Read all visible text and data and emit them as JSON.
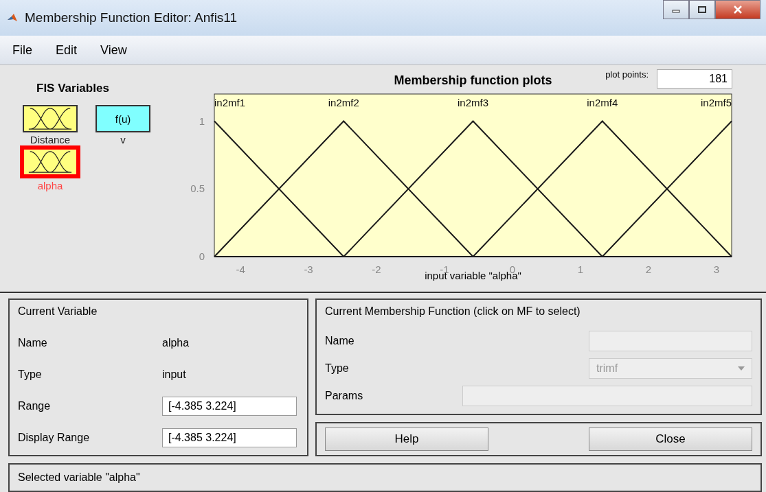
{
  "window": {
    "title": "Membership Function Editor: Anfis11"
  },
  "menu": [
    "File",
    "Edit",
    "View"
  ],
  "fis_variables": {
    "title": "FIS Variables",
    "items": [
      {
        "name": "Distance",
        "kind": "input",
        "selected": false
      },
      {
        "name": "v",
        "kind": "output",
        "icon_text": "f(u)",
        "selected": false
      },
      {
        "name": "alpha",
        "kind": "input",
        "selected": true
      }
    ]
  },
  "plot": {
    "plot_points_label": "plot points:",
    "plot_points": "181",
    "chart_data": {
      "type": "line",
      "title": "Membership function plots",
      "xlabel": "input variable \"alpha\"",
      "x": [
        -4.385,
        -2.483,
        -0.58,
        1.322,
        3.224
      ],
      "xlim": [
        -4.385,
        3.224
      ],
      "ylim": [
        0,
        1.2
      ],
      "xticks": [
        -4,
        -3,
        -2,
        -1,
        0,
        1,
        2,
        3
      ],
      "yticks": [
        0,
        0.5,
        1
      ],
      "series": [
        {
          "name": "in2mf1",
          "color": "#1a1a1a",
          "values": [
            1,
            0,
            0,
            0,
            0
          ]
        },
        {
          "name": "in2mf2",
          "color": "#1a1a1a",
          "values": [
            0,
            1,
            0,
            0,
            0
          ]
        },
        {
          "name": "in2mf3",
          "color": "#1a1a1a",
          "values": [
            0,
            0,
            1,
            0,
            0
          ]
        },
        {
          "name": "in2mf4",
          "color": "#1a1a1a",
          "values": [
            0,
            0,
            0,
            1,
            0
          ]
        },
        {
          "name": "in2mf5",
          "color": "#1a1a1a",
          "values": [
            0,
            0,
            0,
            0,
            1
          ]
        }
      ]
    }
  },
  "current_variable": {
    "title": "Current Variable",
    "name_label": "Name",
    "name": "alpha",
    "type_label": "Type",
    "type": "input",
    "range_label": "Range",
    "range": "[-4.385 3.224]",
    "display_range_label": "Display Range",
    "display_range": "[-4.385 3.224]"
  },
  "current_mf": {
    "title": "Current Membership Function (click on MF to select)",
    "name_label": "Name",
    "type_label": "Type",
    "type": "trimf",
    "params_label": "Params"
  },
  "buttons": [
    "Help",
    "Close"
  ],
  "status": "Selected variable \"alpha\""
}
